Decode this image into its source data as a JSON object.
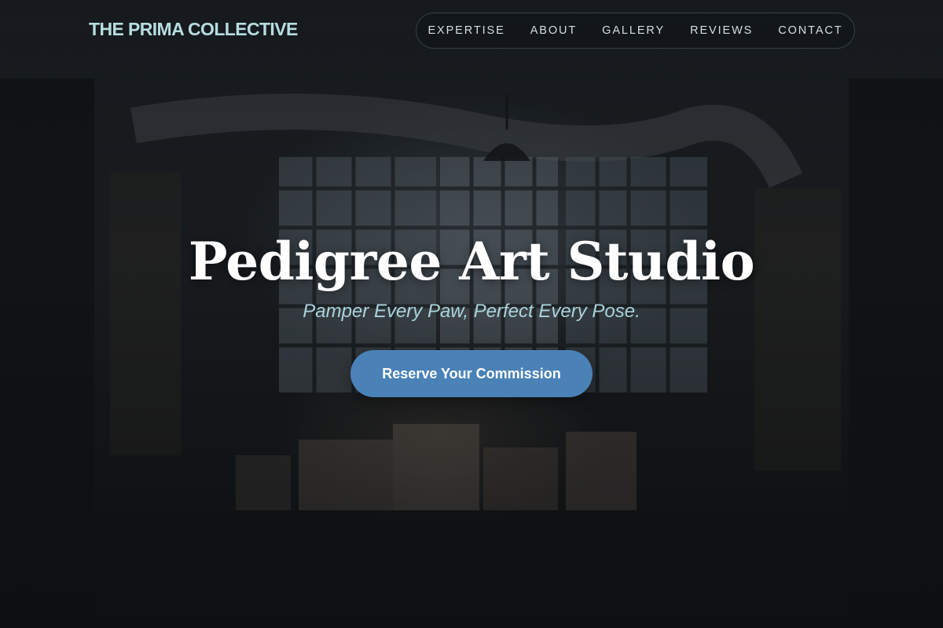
{
  "header": {
    "brand": "THE PRIMA COLLECTIVE",
    "nav": [
      {
        "label": "EXPERTISE"
      },
      {
        "label": "ABOUT"
      },
      {
        "label": "GALLERY"
      },
      {
        "label": "REVIEWS"
      },
      {
        "label": "CONTACT"
      }
    ]
  },
  "hero": {
    "title": "Pedigree Art Studio",
    "tagline": "Pamper Every Paw, Perfect Every Pose.",
    "cta_label": "Reserve Your Commission"
  },
  "colors": {
    "brand": "#b7dde0",
    "tagline": "#a9d3db",
    "cta_background": "#4a82b8",
    "background": "#15181a"
  }
}
